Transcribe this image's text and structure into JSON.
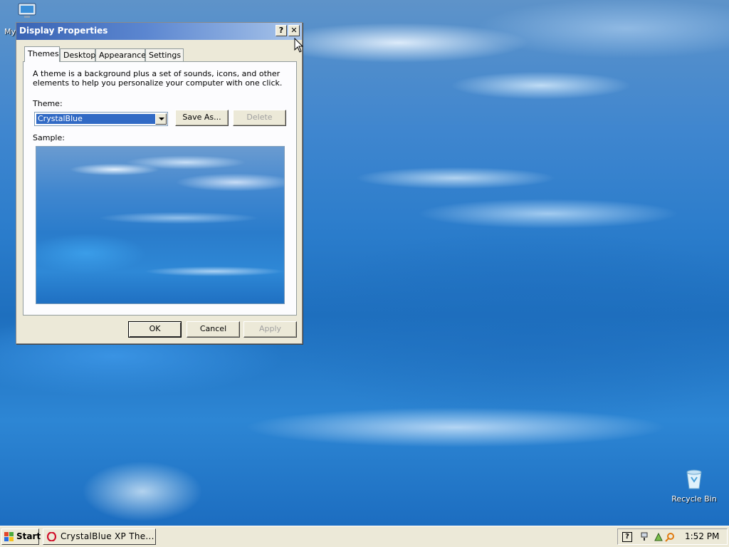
{
  "desktop": {
    "icons": [
      {
        "label": "My"
      },
      {
        "label": "Recycle Bin"
      }
    ]
  },
  "window": {
    "title": "Display Properties",
    "help_glyph": "?",
    "close_glyph": "✕",
    "tabs": [
      {
        "label": "Themes",
        "active": true
      },
      {
        "label": "Desktop"
      },
      {
        "label": "Appearance"
      },
      {
        "label": "Settings"
      }
    ],
    "themes_tab": {
      "description": "A theme is a background plus a set of sounds, icons, and other elements to help you personalize your computer with one click.",
      "theme_label": "Theme:",
      "theme_value": "CrystalBlue",
      "save_as_label": "Save As...",
      "delete_label": "Delete",
      "sample_label": "Sample:"
    },
    "buttons": {
      "ok": "OK",
      "cancel": "Cancel",
      "apply": "Apply"
    }
  },
  "taskbar": {
    "start_label": "Start",
    "task_items": [
      {
        "label": "CrystalBlue XP The...",
        "icon": "opera-icon"
      }
    ],
    "tray": {
      "help_glyph": "?",
      "clock": "1:52 PM"
    }
  },
  "colors": {
    "titlebar": "#3a64b4",
    "selection": "#316ac5",
    "face": "#ece9d8"
  }
}
